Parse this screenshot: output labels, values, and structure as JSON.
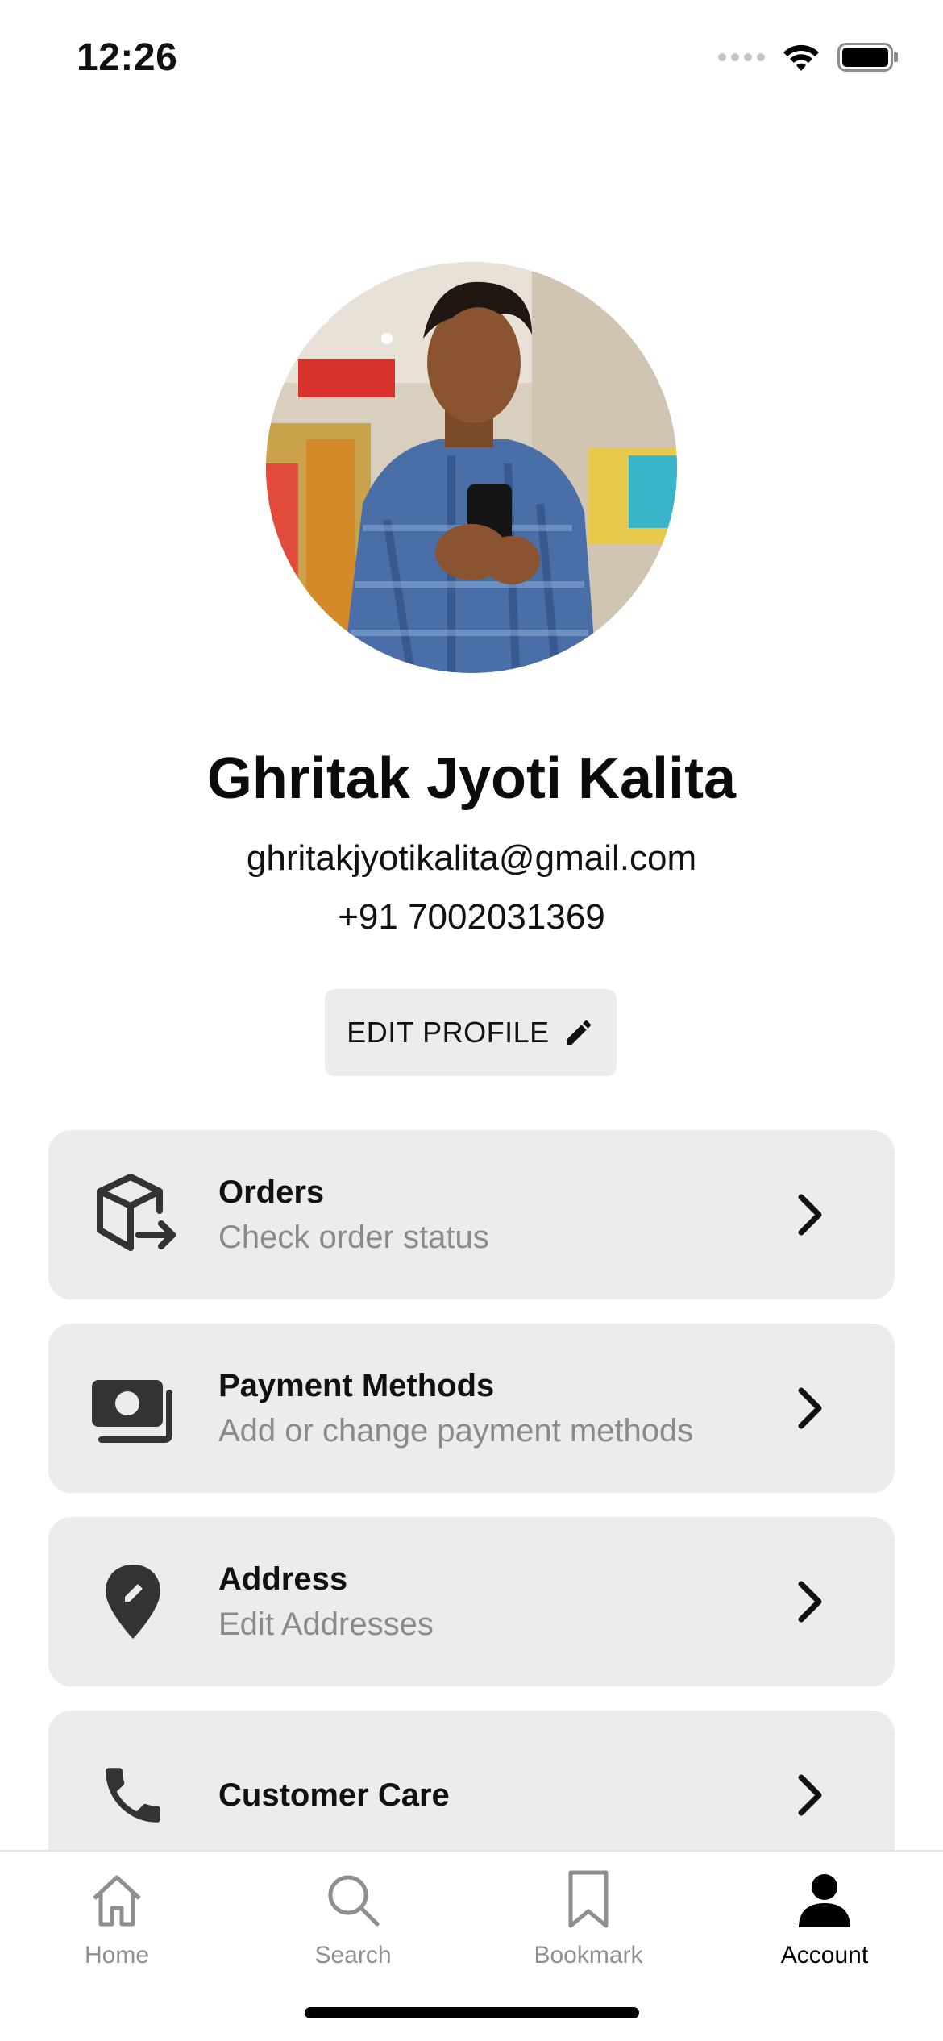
{
  "status_bar": {
    "time": "12:26"
  },
  "profile": {
    "name": "Ghritak Jyoti Kalita",
    "email": "ghritakjyotikalita@gmail.com",
    "phone": "+91 7002031369",
    "edit_label": "EDIT PROFILE"
  },
  "menu": [
    {
      "title": "Orders",
      "subtitle": "Check order status",
      "icon": "box-arrow-icon"
    },
    {
      "title": "Payment Methods",
      "subtitle": "Add or change payment methods",
      "icon": "money-icon"
    },
    {
      "title": "Address",
      "subtitle": "Edit Addresses",
      "icon": "location-pin-icon"
    },
    {
      "title": "Customer Care",
      "subtitle": "",
      "icon": "phone-icon"
    }
  ],
  "tabs": [
    {
      "label": "Home",
      "icon": "home-icon",
      "active": false
    },
    {
      "label": "Search",
      "icon": "search-icon",
      "active": false
    },
    {
      "label": "Bookmark",
      "icon": "bookmark-icon",
      "active": false
    },
    {
      "label": "Account",
      "icon": "person-icon",
      "active": true
    }
  ],
  "colors": {
    "card_bg": "#ececee",
    "subtitle": "#8a8a8e",
    "tab_inactive": "#8e8e93",
    "tab_active": "#000000"
  }
}
